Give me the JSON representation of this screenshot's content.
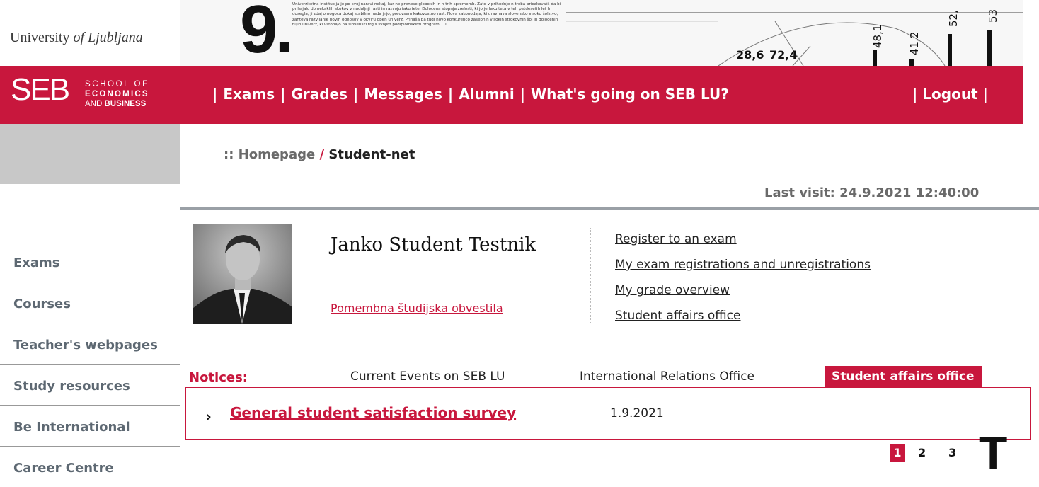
{
  "header": {
    "university_prefix": "University",
    "university_of": "of Ljubljana",
    "banner_number": "9.",
    "banner_text": "Univerzitetna institucija je po svoj naravi nekaj, kar ne prenese globokih in h trih sprememb. Zato v prihodnje n treba pricakovati, da bi prihajalo do nekaklih skokov v nadaljnji rasti in razvoju fakultete. Dolocena stopnja zrelosti, ki jo je fakulteta v teh petdesetih let h dosegla, ji zdaj omogoca dokaj stabilno nada jnjo, predvsem kakovostno rast. Nova zakonodaja, ki uravnava slovensko visoko šolstvo, zahteva razvijanje novih odnosov v okviru obeh univerz. Prinaša pa tudi novo konkurenco zasebnih visokih strokovnih šol in dolocenih tujih univerz, ki vstopajo na slovenski trg s svojim podiplomskimi programi. Ti",
    "banner_values": [
      "28,6",
      "72,4",
      "48,1",
      "41,2",
      "52,",
      "53"
    ],
    "logo_seb": "SEB",
    "logo_line1": "SCHOOL OF",
    "logo_line2": "ECONOMICS",
    "logo_line3_a": "AND",
    "logo_line3_b": "BUSINESS"
  },
  "nav": {
    "sep": "|",
    "items": [
      "Exams",
      "Grades",
      "Messages",
      "Alumni",
      "What's going on SEB LU?"
    ],
    "logout": "Logout"
  },
  "breadcrumb": {
    "home": ":: Homepage",
    "slash": "/",
    "current": "Student-net"
  },
  "last_visit": {
    "label": "Last visit:",
    "value": "24.9.2021 12:40:00"
  },
  "sidebar": {
    "items": [
      "Exams",
      "Courses",
      "Teacher's webpages",
      "Study resources",
      "Be International",
      "Career Centre"
    ]
  },
  "profile": {
    "name": "Janko Student Testnik",
    "link": "Pomembna študijska obvestila"
  },
  "quick_links": [
    "Register to an exam",
    "My exam registrations and unregistrations",
    "My grade overview",
    "Student affairs office"
  ],
  "notices": {
    "label": "Notices:",
    "tabs": [
      "Current Events on SEB LU",
      "International Relations Office",
      "Student affairs office"
    ],
    "active_tab": "Student affairs office",
    "items": [
      {
        "title": "General student satisfaction survey",
        "date": "1.9.2021"
      }
    ]
  },
  "pagination": {
    "pages": [
      "1",
      "2",
      "3"
    ],
    "current": "1"
  },
  "overlay_letter": "T",
  "colors": {
    "accent": "#c8173d",
    "sidebar_text": "#5d6872",
    "grey": "#c8c8c8"
  }
}
